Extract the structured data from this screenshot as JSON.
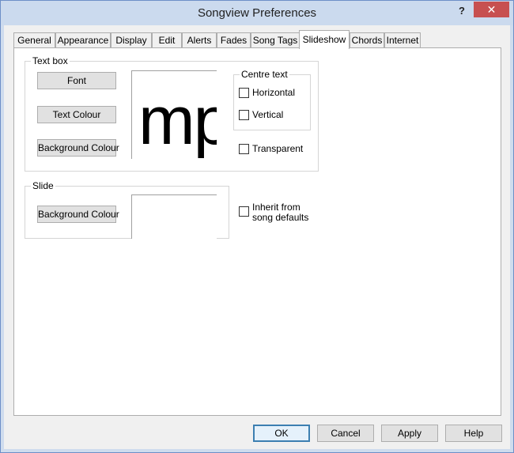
{
  "window": {
    "title": "Songview Preferences",
    "help_glyph": "?",
    "close_glyph": "✕"
  },
  "tabs": [
    {
      "label": "General"
    },
    {
      "label": "Appearance"
    },
    {
      "label": "Display"
    },
    {
      "label": "Edit"
    },
    {
      "label": "Alerts"
    },
    {
      "label": "Fades"
    },
    {
      "label": "Song Tags"
    },
    {
      "label": "Slideshow",
      "active": true
    },
    {
      "label": "Chords"
    },
    {
      "label": "Internet"
    }
  ],
  "text_box": {
    "label": "Text box",
    "font_button": "Font",
    "text_colour_button": "Text Colour",
    "background_colour_button": "Background Colour",
    "preview_text": "mp",
    "centre_text": {
      "label": "Centre text",
      "horizontal": {
        "label": "Horizontal",
        "checked": false
      },
      "vertical": {
        "label": "Vertical",
        "checked": false
      }
    },
    "transparent": {
      "label": "Transparent",
      "checked": false
    }
  },
  "slide": {
    "label": "Slide",
    "background_colour_button": "Background Colour",
    "inherit": {
      "label_line1": "Inherit from",
      "label_line2": "song defaults",
      "checked": false
    }
  },
  "footer": {
    "ok": "OK",
    "cancel": "Cancel",
    "apply": "Apply",
    "help": "Help"
  },
  "colors": {
    "titlebar": "#cbdaee",
    "close_button": "#c75050",
    "panel_background": "#ffffff"
  }
}
